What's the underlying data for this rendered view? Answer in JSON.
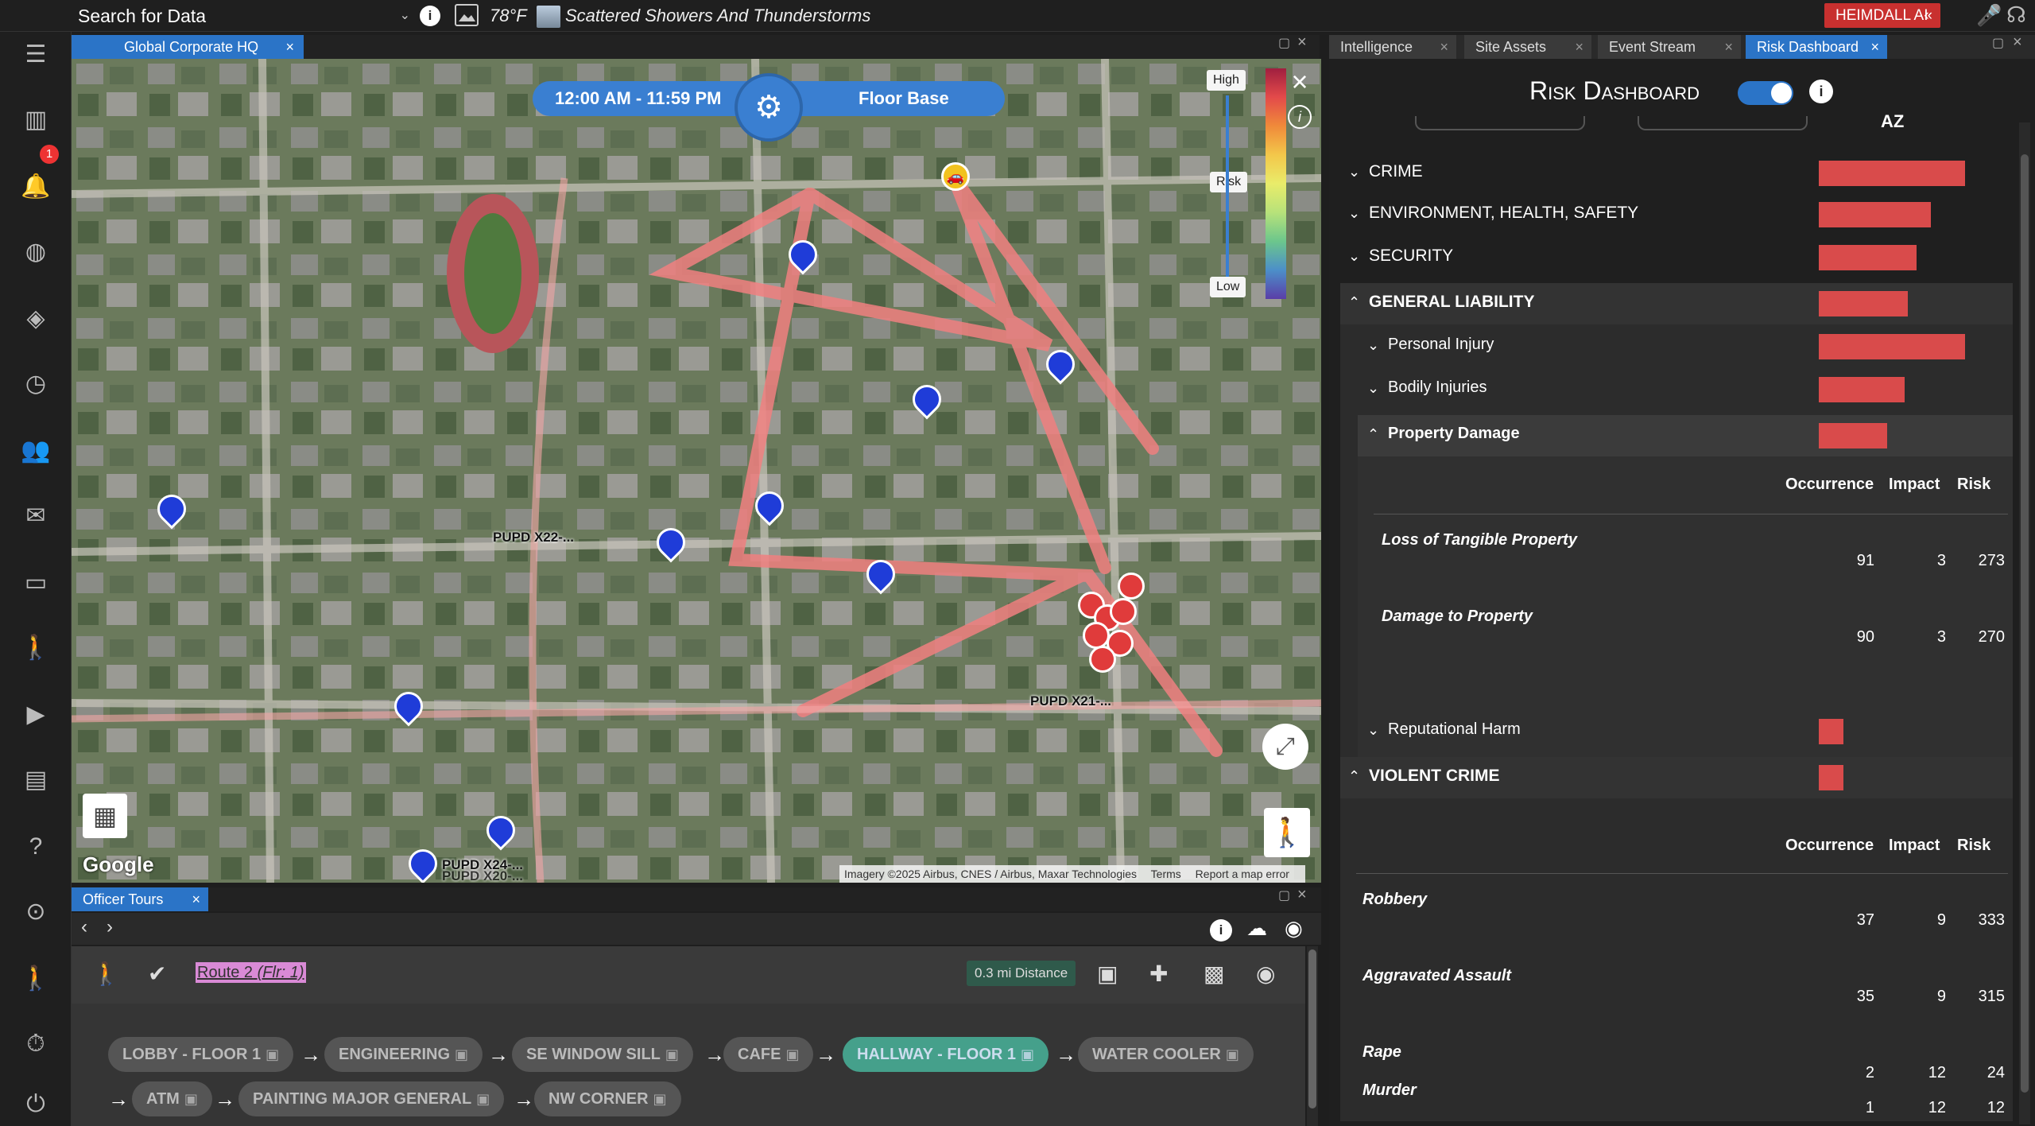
{
  "topbar": {
    "search_label": "Search for Data",
    "temperature": "78°F",
    "weather": "Scattered Showers And Thunderstorms",
    "heimdall_label": "HEIMDALL AI",
    "heimdall_chevron": "«"
  },
  "leftrail": {
    "notification_count": "1"
  },
  "map": {
    "tab_label": "Global Corporate HQ",
    "time_range": "12:00 AM - 11:59 PM",
    "floor": "Floor Base",
    "legend_high": "High",
    "legend_mid": "Risk",
    "legend_low": "Low",
    "labels": [
      "PUPD X22-...",
      "PUPD X21-...",
      "PUPD X24-...",
      "PUPD X20-..."
    ],
    "logo": "Google",
    "attribution": "Imagery ©2025 Airbus, CNES / Airbus, Maxar Technologies",
    "terms": "Terms",
    "report": "Report a map error"
  },
  "tours": {
    "tab_label": "Officer Tours",
    "route_name": "Route 2",
    "route_floor": "(Flr: 1)",
    "distance": "0.3 mi Distance",
    "stops": [
      {
        "label": "LOBBY - FLOOR 1",
        "active": false
      },
      {
        "label": "ENGINEERING",
        "active": false
      },
      {
        "label": "SE WINDOW SILL",
        "active": false
      },
      {
        "label": "CAFE",
        "active": false
      },
      {
        "label": "HALLWAY - FLOOR 1",
        "active": true
      },
      {
        "label": "WATER COOLER",
        "active": false
      },
      {
        "label": "ATM",
        "active": false
      },
      {
        "label": "PAINTING MAJOR GENERAL",
        "active": false
      },
      {
        "label": "NW CORNER",
        "active": false
      }
    ]
  },
  "right_tabs": [
    {
      "label": "Intelligence",
      "active": false
    },
    {
      "label": "Site Assets",
      "active": false
    },
    {
      "label": "Event Stream",
      "active": false
    },
    {
      "label": "Risk Dashboard",
      "active": true
    }
  ],
  "risk_dashboard": {
    "title": "Risk Dashboard",
    "categories": [
      {
        "label": "CRIME",
        "level": 0.94
      },
      {
        "label": "ENVIRONMENT, HEALTH, SAFETY",
        "level": 0.72
      },
      {
        "label": "SECURITY",
        "level": 0.63
      }
    ],
    "general_liability": {
      "label": "GENERAL LIABILITY",
      "level": 0.57,
      "sub": [
        {
          "label": "Personal Injury",
          "level": 0.94
        },
        {
          "label": "Bodily Injuries",
          "level": 0.55
        }
      ],
      "property_damage": {
        "label": "Property Damage",
        "level": 0.44,
        "headers": [
          "Occurrence",
          "Impact",
          "Risk"
        ],
        "items": [
          {
            "name": "Loss of Tangible Property",
            "occurrence": "91",
            "impact": "3",
            "risk": "273"
          },
          {
            "name": "Damage to Property",
            "occurrence": "90",
            "impact": "3",
            "risk": "270"
          }
        ]
      },
      "reputational": {
        "label": "Reputational Harm",
        "level": 0.16
      }
    },
    "violent_crime": {
      "label": "VIOLENT CRIME",
      "level": 0.16,
      "headers": [
        "Occurrence",
        "Impact",
        "Risk"
      ],
      "items": [
        {
          "name": "Robbery",
          "occurrence": "37",
          "impact": "9",
          "risk": "333"
        },
        {
          "name": "Aggravated Assault",
          "occurrence": "35",
          "impact": "9",
          "risk": "315"
        },
        {
          "name": "Rape",
          "occurrence": "2",
          "impact": "12",
          "risk": "24"
        },
        {
          "name": "Murder",
          "occurrence": "1",
          "impact": "12",
          "risk": "12"
        }
      ]
    }
  }
}
